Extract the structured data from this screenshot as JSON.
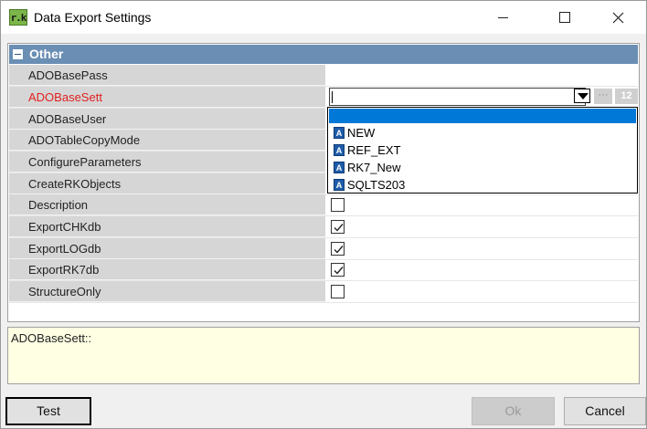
{
  "window": {
    "title": "Data Export Settings",
    "app_icon_text": "r.k"
  },
  "category": {
    "label": "Other"
  },
  "properties": [
    {
      "name": "ADOBasePass",
      "value_type": "text",
      "value": ""
    },
    {
      "name": "ADOBaseSett",
      "value_type": "dropdown",
      "value": "",
      "active": true
    },
    {
      "name": "ADOBaseUser",
      "value_type": "text",
      "value": ""
    },
    {
      "name": "ADOTableCopyMode",
      "value_type": "text",
      "value": ""
    },
    {
      "name": "ConfigureParameters",
      "value_type": "text",
      "value": ""
    },
    {
      "name": "CreateRKObjects",
      "value_type": "text",
      "value": ""
    },
    {
      "name": "Description",
      "value_type": "checkbox",
      "checked": false
    },
    {
      "name": "ExportCHKdb",
      "value_type": "checkbox",
      "checked": true
    },
    {
      "name": "ExportLOGdb",
      "value_type": "checkbox",
      "checked": true
    },
    {
      "name": "ExportRK7db",
      "value_type": "checkbox",
      "checked": true
    },
    {
      "name": "StructureOnly",
      "value_type": "checkbox",
      "checked": false
    }
  ],
  "editor": {
    "ellipsis_label": "···",
    "number_label": "12"
  },
  "dropdown": {
    "items": [
      "NEW",
      "REF_EXT",
      "RK7_New",
      "SQLTS203"
    ],
    "item_icon_glyph": "A"
  },
  "description": {
    "text": "ADOBaseSett::"
  },
  "buttons": {
    "test": "Test",
    "ok": "Ok",
    "cancel": "Cancel"
  },
  "colors": {
    "category_bg": "#6a8eb4",
    "active_label": "#e02020",
    "selection": "#0078d7",
    "description_bg": "#ffffe3"
  }
}
